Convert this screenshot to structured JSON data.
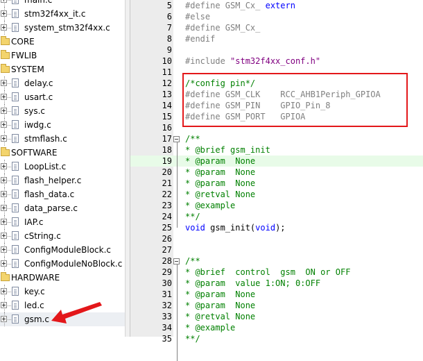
{
  "tree": {
    "items": [
      {
        "label": "main.c",
        "kind": "file"
      },
      {
        "label": "stm32f4xx_it.c",
        "kind": "file"
      },
      {
        "label": "system_stm32f4xx.c",
        "kind": "file"
      },
      {
        "label": "CORE",
        "kind": "group",
        "expanded": false
      },
      {
        "label": "FWLIB",
        "kind": "group",
        "expanded": false
      },
      {
        "label": "SYSTEM",
        "kind": "group",
        "expanded": true
      },
      {
        "label": "delay.c",
        "kind": "file"
      },
      {
        "label": "usart.c",
        "kind": "file"
      },
      {
        "label": "sys.c",
        "kind": "file"
      },
      {
        "label": "iwdg.c",
        "kind": "file"
      },
      {
        "label": "stmflash.c",
        "kind": "file"
      },
      {
        "label": "SOFTWARE",
        "kind": "group",
        "expanded": true
      },
      {
        "label": "LoopList.c",
        "kind": "file"
      },
      {
        "label": "flash_helper.c",
        "kind": "file"
      },
      {
        "label": "flash_data.c",
        "kind": "file"
      },
      {
        "label": "data_parse.c",
        "kind": "file"
      },
      {
        "label": "IAP.c",
        "kind": "file"
      },
      {
        "label": "cString.c",
        "kind": "file"
      },
      {
        "label": "ConfigModuleBlock.c",
        "kind": "file"
      },
      {
        "label": "ConfigModuleNoBlock.c",
        "kind": "file"
      },
      {
        "label": "HARDWARE",
        "kind": "group",
        "expanded": true
      },
      {
        "label": "key.c",
        "kind": "file"
      },
      {
        "label": "led.c",
        "kind": "file"
      },
      {
        "label": "gsm.c",
        "kind": "file",
        "selected": true
      }
    ]
  },
  "editor": {
    "lines": [
      {
        "num": "5",
        "tokens": [
          [
            "pp",
            "#define GSM_Cx_ "
          ],
          [
            "kw",
            "extern"
          ]
        ]
      },
      {
        "num": "6",
        "tokens": [
          [
            "pp",
            "#else"
          ]
        ]
      },
      {
        "num": "7",
        "tokens": [
          [
            "pp",
            "#define GSM_Cx_"
          ]
        ]
      },
      {
        "num": "8",
        "tokens": [
          [
            "pp",
            "#endif"
          ]
        ]
      },
      {
        "num": "9",
        "tokens": []
      },
      {
        "num": "10",
        "tokens": [
          [
            "pp",
            "#include "
          ],
          [
            "str",
            "\"stm32f4xx_conf.h\""
          ]
        ]
      },
      {
        "num": "11",
        "tokens": []
      },
      {
        "num": "12",
        "tokens": [
          [
            "cm",
            "/*config pin*/"
          ]
        ]
      },
      {
        "num": "13",
        "tokens": [
          [
            "pp",
            "#define GSM_CLK    RCC_AHB1Periph_GPIOA"
          ]
        ]
      },
      {
        "num": "14",
        "tokens": [
          [
            "pp",
            "#define GSM_PIN    GPIO_Pin_8"
          ]
        ]
      },
      {
        "num": "15",
        "tokens": [
          [
            "pp",
            "#define GSM_PORT   GPIOA"
          ]
        ]
      },
      {
        "num": "16",
        "tokens": []
      },
      {
        "num": "17",
        "tokens": [
          [
            "cm",
            "/**"
          ]
        ],
        "fold": "open"
      },
      {
        "num": "18",
        "tokens": [
          [
            "cm",
            "* @brief gsm_init"
          ]
        ]
      },
      {
        "num": "19",
        "tokens": [
          [
            "cm",
            "* @param  None"
          ]
        ],
        "highlight": true
      },
      {
        "num": "20",
        "tokens": [
          [
            "cm",
            "* @param  None"
          ]
        ]
      },
      {
        "num": "21",
        "tokens": [
          [
            "cm",
            "* @param  None"
          ]
        ]
      },
      {
        "num": "22",
        "tokens": [
          [
            "cm",
            "* @retval None"
          ]
        ]
      },
      {
        "num": "23",
        "tokens": [
          [
            "cm",
            "* @example"
          ]
        ]
      },
      {
        "num": "24",
        "tokens": [
          [
            "cm",
            "**/"
          ]
        ]
      },
      {
        "num": "25",
        "tokens": [
          [
            "kw",
            "void"
          ],
          [
            "pl",
            " gsm_init("
          ],
          [
            "kw",
            "void"
          ],
          [
            "pl",
            ");"
          ]
        ]
      },
      {
        "num": "26",
        "tokens": []
      },
      {
        "num": "27",
        "tokens": []
      },
      {
        "num": "28",
        "tokens": [
          [
            "cm",
            "/**"
          ]
        ],
        "fold": "open"
      },
      {
        "num": "29",
        "tokens": [
          [
            "cm",
            "* @brief  control  gsm  ON or OFF"
          ]
        ]
      },
      {
        "num": "30",
        "tokens": [
          [
            "cm",
            "* @param  value 1:ON; 0:OFF"
          ]
        ]
      },
      {
        "num": "31",
        "tokens": [
          [
            "cm",
            "* @param  None"
          ]
        ]
      },
      {
        "num": "32",
        "tokens": [
          [
            "cm",
            "* @param  None"
          ]
        ]
      },
      {
        "num": "33",
        "tokens": [
          [
            "cm",
            "* @retval None"
          ]
        ]
      },
      {
        "num": "34",
        "tokens": [
          [
            "cm",
            "* @example"
          ]
        ]
      },
      {
        "num": "35",
        "tokens": [
          [
            "cm",
            "**/"
          ]
        ]
      }
    ]
  },
  "colors": {
    "preprocessor": "#808080",
    "keyword": "#0000ff",
    "string": "#800080",
    "comment": "#008000",
    "annotation_box": "#e3171a",
    "annotation_arrow": "#e3171a"
  }
}
